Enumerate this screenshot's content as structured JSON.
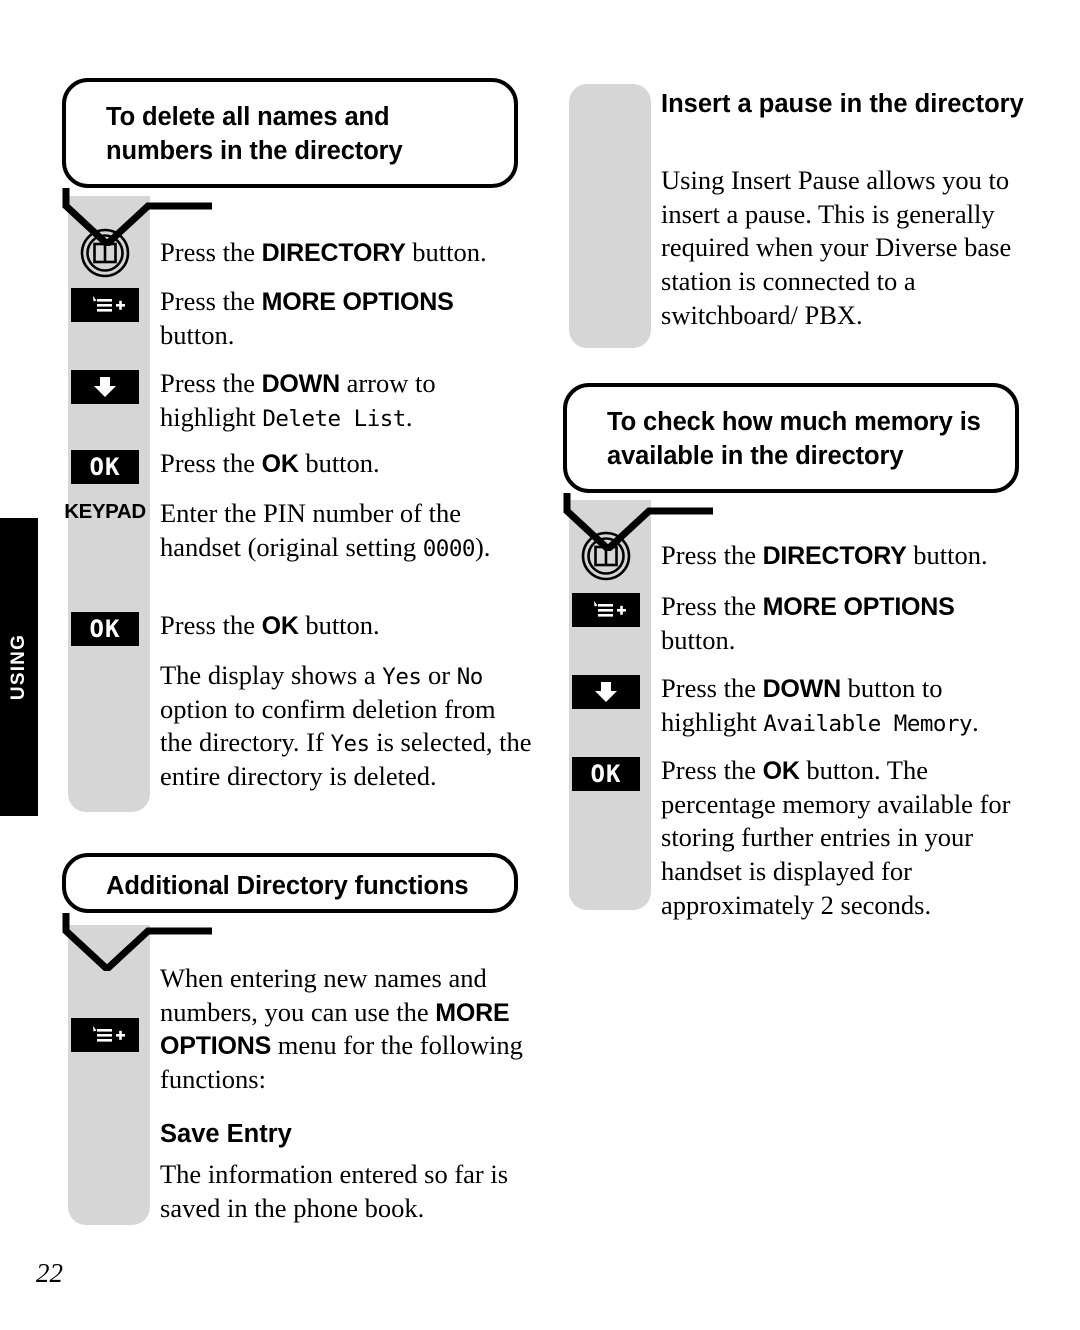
{
  "page": {
    "number": "22",
    "side_tab_label": "USING",
    "colors": {
      "rail": "#d6d6d6",
      "key": "#000000",
      "text": "#000000"
    }
  },
  "left_column": {
    "callout_1": {
      "title": "To delete all names and numbers in the directory"
    },
    "steps_1": [
      {
        "icon": "directory-icon",
        "icon_label": "",
        "text_html": "Press the <b>DIRECTORY</b> button."
      },
      {
        "icon": "more-options-icon",
        "icon_label": "",
        "text_html": "Press the <b>MORE OPTIONS</b> button."
      },
      {
        "icon": "down-arrow-icon",
        "icon_label": "",
        "text_html": "Press the <b>DOWN</b> arrow to highlight <span class=\"lcd\">Delete List</span>."
      },
      {
        "icon": "ok-key-icon",
        "icon_label": "OK",
        "text_html": "Press the <b>OK</b> button."
      },
      {
        "icon": "keypad-icon",
        "icon_label": "KEYPAD",
        "text_html": "Enter the PIN number of the handset (original setting <span class=\"lcd\">0000</span>)."
      },
      {
        "icon": "ok-key-icon",
        "icon_label": "OK",
        "text_html": "Press the <b>OK</b> button."
      },
      {
        "icon": "none",
        "icon_label": "",
        "text_html": "The display shows a <span class=\"lcd\">Yes</span> or <span class=\"lcd\">No</span> option to confirm deletion from the directory. If <span class=\"lcd\">Yes</span> is selected, the entire directory is deleted."
      }
    ],
    "callout_2": {
      "title": "Additional Directory functions"
    },
    "steps_2": [
      {
        "icon": "more-options-icon",
        "icon_label": "",
        "text_html": "When entering new names and numbers, you can use the <b>MORE OPTIONS</b> menu for the following functions:"
      }
    ],
    "subsection": {
      "heading": "Save Entry",
      "body": "The information entered so far is saved in the phone book."
    }
  },
  "right_column": {
    "section_1": {
      "heading": "Insert a pause in the directory",
      "body": "Using Insert Pause allows you to insert a pause. This is generally required when your Diverse base station is connected to a switchboard/ PBX."
    },
    "callout_1": {
      "title": "To check how much memory is available in the directory"
    },
    "steps_1": [
      {
        "icon": "directory-icon",
        "icon_label": "",
        "text_html": "Press the <b>DIRECTORY</b> button."
      },
      {
        "icon": "more-options-icon",
        "icon_label": "",
        "text_html": "Press the <b>MORE OPTIONS</b> button."
      },
      {
        "icon": "down-arrow-icon",
        "icon_label": "",
        "text_html": "Press the <b>DOWN</b> button to highlight <span class=\"lcd\">Available Memory</span>."
      },
      {
        "icon": "ok-key-icon",
        "icon_label": "OK",
        "text_html": "Press the <b>OK</b> button. The percentage memory available for storing further entries in your handset is displayed for approximately 2 seconds."
      }
    ]
  }
}
